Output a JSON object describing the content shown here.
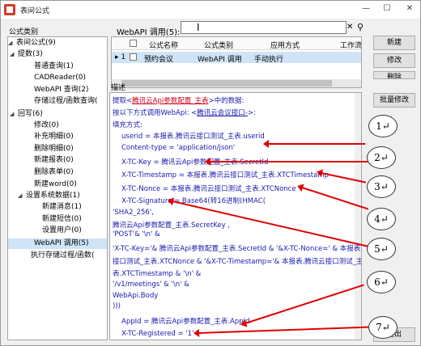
{
  "window": {
    "title": "表间公式",
    "min": "—",
    "max": "☐",
    "close": "✕"
  },
  "labels": {
    "category": "公式类别",
    "api_call": "WebAPI 调用(5):",
    "description": "描述"
  },
  "search": {
    "value": "",
    "cursor": "I",
    "clear": "✕",
    "search_glyph": "⚲"
  },
  "tree": [
    {
      "label": "表间公式(9)",
      "arrow": "◢"
    },
    {
      "label": "提数(3)",
      "arrow": "◢"
    },
    {
      "label": "普通查询(1)",
      "arrow": ""
    },
    {
      "label": "CADReader(0)",
      "arrow": ""
    },
    {
      "label": "WebAPI 查询(2)",
      "arrow": ""
    },
    {
      "label": "存储过程/函数查询(",
      "arrow": ""
    },
    {
      "label": "回写(6)",
      "arrow": "◢"
    },
    {
      "label": "修改(0)",
      "arrow": ""
    },
    {
      "label": "补充明细(0)",
      "arrow": ""
    },
    {
      "label": "删除明细(0)",
      "arrow": ""
    },
    {
      "label": "新建报表(0)",
      "arrow": ""
    },
    {
      "label": "删除表单(0)",
      "arrow": ""
    },
    {
      "label": "新建word(0)",
      "arrow": ""
    },
    {
      "label": "设置系统数据(1)",
      "arrow": "◢"
    },
    {
      "label": "新建消息(1)",
      "arrow": ""
    },
    {
      "label": "新建短信(0)",
      "arrow": ""
    },
    {
      "label": "设置用户(0)",
      "arrow": ""
    },
    {
      "label": "WebAPI 调用(5)",
      "arrow": ""
    },
    {
      "label": "执行存储过程/函数(",
      "arrow": ""
    }
  ],
  "grid": {
    "headers": [
      "公式名称",
      "公式类别",
      "应用方式",
      "工作流"
    ],
    "row": {
      "marker": "▸ 1",
      "name": "预约会议",
      "category": "WebAPI 调用",
      "mode": "手动执行"
    }
  },
  "buttons": {
    "new": "新建",
    "modify": "修改",
    "delete": "删除",
    "batch": "批量修改",
    "exit": "退出"
  },
  "desc_lines": [
    {
      "segs": [
        {
          "t": "提取<",
          "c": ""
        },
        {
          "t": "腾讯云Api参数配置_主表",
          "c": "red ul"
        },
        {
          "t": ">中的数据:",
          "c": ""
        }
      ]
    },
    {
      "segs": [
        {
          "t": "按以下方式调用WebApi: <",
          "c": ""
        },
        {
          "t": "腾讯云会议接口-",
          "c": "ul"
        },
        {
          "t": ">:",
          "c": ""
        }
      ]
    },
    {
      "segs": [
        {
          "t": "填充方式:",
          "c": ""
        }
      ]
    },
    {
      "segs": [
        {
          "t": "userid = 本报表.腾讯云接口测试_主表.userid",
          "c": ""
        }
      ]
    },
    {
      "segs": [
        {
          "t": "Content-type = 'application/json'",
          "c": ""
        }
      ]
    },
    {
      "segs": [
        {
          "t": "X-TC-Key = 腾讯云Api参数配置_主表.SecretId",
          "c": ""
        }
      ]
    },
    {
      "segs": [
        {
          "t": "X-TC-Timestamp = 本报表.腾讯云接口测试_主表.XTCTimestamp",
          "c": ""
        }
      ]
    },
    {
      "segs": [
        {
          "t": "X-TC-Nonce = 本报表.腾讯云接口测试_主表.XTCNonce",
          "c": ""
        }
      ]
    },
    {
      "segs": [
        {
          "t": "X-TC-Signature = Base64(转16进制(HMAC(",
          "c": ""
        }
      ]
    },
    {
      "segs": [
        {
          "t": "'SHA2_256',",
          "c": ""
        }
      ]
    },
    {
      "segs": [
        {
          "t": "腾讯云Api参数配置_主表.SecretKey ,",
          "c": ""
        }
      ]
    },
    {
      "segs": [
        {
          "t": "'POST'& '\\n' &",
          "c": ""
        }
      ]
    },
    {
      "segs": [
        {
          "t": "'X-TC-Key='& 腾讯云Api参数配置_主表.SecretId & '&X-TC-Nonce=' & 本报表.腾讯云",
          "c": ""
        }
      ]
    },
    {
      "segs": [
        {
          "t": "接口测试_主表.XTCNonce & '&X-TC-Timestamp='& 本报表.腾讯云接口测试_主",
          "c": ""
        }
      ]
    },
    {
      "segs": [
        {
          "t": "表.XTCTimestamp & '\\n' &",
          "c": ""
        }
      ]
    },
    {
      "segs": [
        {
          "t": "'/v1/meetings' & '\\n' &",
          "c": ""
        }
      ]
    },
    {
      "segs": [
        {
          "t": "WebApi.Body",
          "c": ""
        }
      ]
    },
    {
      "segs": [
        {
          "t": ")))",
          "c": ""
        }
      ]
    },
    {
      "segs": [
        {
          "t": "AppId = 腾讯云Api参数配置_主表.AppId",
          "c": ""
        }
      ]
    },
    {
      "segs": [
        {
          "t": "X-TC-Registered = '1'",
          "c": ""
        }
      ]
    }
  ],
  "callouts": [
    "1↵",
    "2↵",
    "3↵",
    "4↵",
    "5↵",
    "6↵",
    "7↵"
  ],
  "colors": {
    "annotation": "#e00000",
    "link_text": "#1a1ab0",
    "highlight": "#d0021b",
    "selection": "#cfe4f7"
  }
}
